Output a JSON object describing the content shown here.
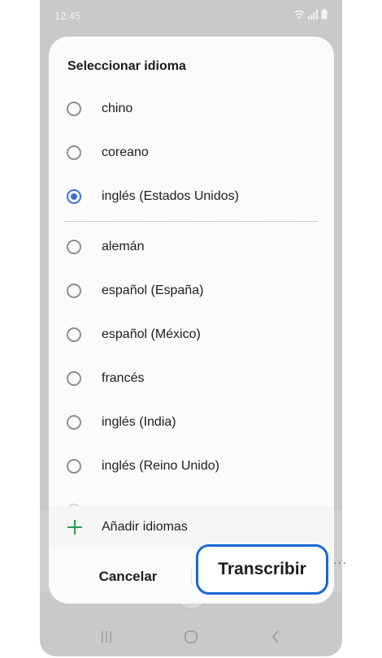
{
  "status_bar": {
    "time": "12:45"
  },
  "dialog": {
    "title": "Seleccionar idioma",
    "selected_options": [
      {
        "label": "chino",
        "checked": false
      },
      {
        "label": "coreano",
        "checked": false
      },
      {
        "label": "inglés (Estados Unidos)",
        "checked": true
      }
    ],
    "other_options": [
      {
        "label": "alemán",
        "checked": false
      },
      {
        "label": "español (España)",
        "checked": false
      },
      {
        "label": "español (México)",
        "checked": false
      },
      {
        "label": "francés",
        "checked": false
      },
      {
        "label": "inglés (India)",
        "checked": false
      },
      {
        "label": "inglés (Reino Unido)",
        "checked": false
      }
    ],
    "add_languages_label": "Añadir idiomas",
    "cancel_label": "Cancelar",
    "transcribe_label": "Transcribir"
  },
  "colors": {
    "accent": "#3e6fd8",
    "highlight_border": "#1a66d9",
    "add_icon": "#2e9e4f"
  },
  "icons": [
    "wifi-icon",
    "signal-icon",
    "battery-icon",
    "plus-icon",
    "recents-icon",
    "home-icon",
    "back-icon"
  ]
}
